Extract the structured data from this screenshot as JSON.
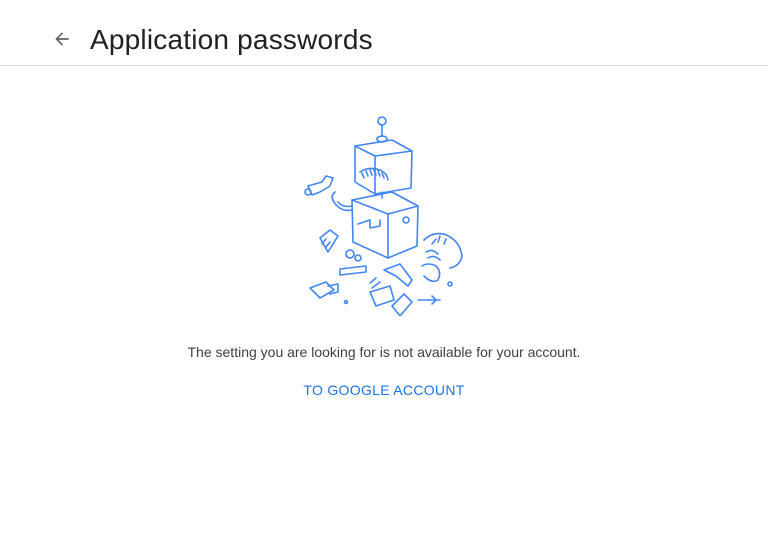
{
  "header": {
    "back_icon": "arrow-back-icon",
    "title": "Application passwords"
  },
  "main": {
    "illustration": "broken-robot-illustration",
    "message": "The setting you are looking for is not available for your account.",
    "link_label": "TO GOOGLE ACCOUNT"
  },
  "colors": {
    "accent": "#1a73e8",
    "illustration_stroke": "#4285f4",
    "divider": "#dadce0"
  }
}
